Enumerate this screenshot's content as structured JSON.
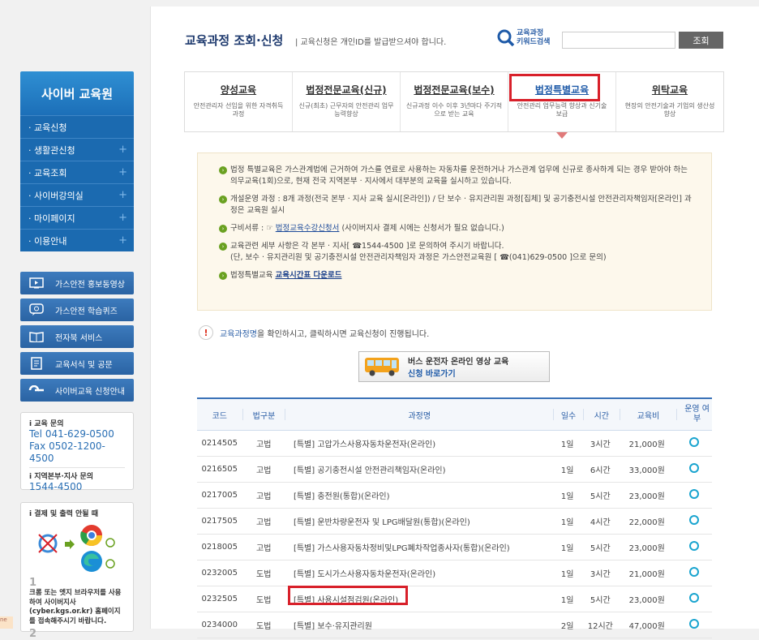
{
  "sidebar": {
    "title": "사이버 교육원",
    "menu": [
      {
        "label": "· 교육신청",
        "plus": ""
      },
      {
        "label": "· 생활관신청",
        "plus": "+"
      },
      {
        "label": "· 교육조회",
        "plus": "+"
      },
      {
        "label": "· 사이버강의실",
        "plus": "+"
      },
      {
        "label": "· 마이페이지",
        "plus": "+"
      },
      {
        "label": "· 이용안내",
        "plus": "+"
      }
    ],
    "quick": [
      {
        "label": "가스안전 홍보동영상",
        "icon": "video-icon"
      },
      {
        "label": "가스안전 학습퀴즈",
        "icon": "quiz-icon"
      },
      {
        "label": "전자북 서비스",
        "icon": "book-icon"
      },
      {
        "label": "교육서식 및 공문",
        "icon": "document-icon"
      },
      {
        "label": "사이버교육 신청안내",
        "icon": "guide-icon"
      }
    ],
    "contact": {
      "label1": "i 교육 문의",
      "tel": "Tel 041-629-0500",
      "fax": "Fax 0502-1200-4500",
      "label2": "i 지역본부·지사 문의",
      "branch_tel": "1544-4500"
    },
    "browser": {
      "label": "i 결제 및 출력 안될 때",
      "step": "1",
      "text": "크롬 또는 엣지 브라우저를 사용하여 사이버지사 (cyber.kgs.or.kr) 홈페이지를 접속해주시기 바랍니다.",
      "step2": "2"
    },
    "corner": "ne"
  },
  "header": {
    "title": "교육과정 조회·신청",
    "subtitle": "| 교육신청은 개인ID를 발급받으셔야 합니다.",
    "keyword_label_1": "교육과정",
    "keyword_label_2": "키워드검색",
    "search_button": "조회"
  },
  "tabs": [
    {
      "label": "양성교육",
      "desc": "안전관리자 선임을 위한 자격취득 과정"
    },
    {
      "label": "법정전문교육(신규)",
      "desc": "신규(최초) 근무자의 안전관리 업무능력향상"
    },
    {
      "label": "법정전문교육(보수)",
      "desc": "신규과정 이수 이후 3년마다 주기적으로 받는 교육"
    },
    {
      "label": "법정특별교육",
      "desc": "안전관리 업무능력 향상과 신기술 보급"
    },
    {
      "label": "위탁교육",
      "desc": "현장의 안전기술과 기업의 생산성 향상"
    }
  ],
  "info": {
    "p1": "법정 특별교육은 가스관계법에 근거하여 가스를 연료로 사용하는 자동차를 운전하거나 가스관계 업무에 신규로 종사하게 되는 경우 받아야 하는 의무교육(1회)으로, 현재 전국 지역본부 · 지사에서 대부분의 교육을 실시하고 있습니다.",
    "p2": "개설운영 과정 : 8개 과정(전국 본부 · 지사 교육 실시[온라인]) / 단 보수 · 유지관리원 과정[집체] 및 공기충전시설 안전관리자책임자[온라인] 과정은 교육원 실시",
    "p3_pre": "구비서류 : ☞",
    "p3_link": "법정교육수강신청서",
    "p3_post": "(사이버지사 결제 시에는 신청서가 필요 없습니다.)",
    "p4a": "교육관련 세부 사항은 각 본부 · 지사[ ☎1544-4500 ]로 문의하여 주시기 바랍니다.",
    "p4b": "(단, 보수 · 유지관리원 및 공기충전시설 안전관리자책임자 과정은 가스안전교육원 [ ☎(041)629-0500 ]으로 문의)",
    "p5_pre": "법정특별교육",
    "p5_link": "교육시간표 다운로드"
  },
  "notice": {
    "highlight": "교육과정명",
    "text": "을 확인하시고, 클릭하시면 교육신청이 진행됩니다."
  },
  "bus_banner": {
    "line1": "버스 운전자 온라인 영상 교육",
    "line2": "신청 바로가기"
  },
  "table": {
    "headers": {
      "code": "코드",
      "law": "법구분",
      "course": "과정명",
      "days": "일수",
      "hours": "시간",
      "fee": "교육비",
      "status": "운영 여부"
    },
    "rows": [
      {
        "code": "0214505",
        "law": "고법",
        "course": "[특별] 고압가스사용자동차운전자(온라인)",
        "days": "1일",
        "hours": "3시간",
        "fee": "21,000원"
      },
      {
        "code": "0216505",
        "law": "고법",
        "course": "[특별] 공기충전시설 안전관리책임자(온라인)",
        "days": "1일",
        "hours": "6시간",
        "fee": "33,000원"
      },
      {
        "code": "0217005",
        "law": "고법",
        "course": "[특별] 충전원(통합)(온라인)",
        "days": "1일",
        "hours": "5시간",
        "fee": "23,000원"
      },
      {
        "code": "0217505",
        "law": "고법",
        "course": "[특별] 운반차량운전자 및 LPG배달원(통합)(온라인)",
        "days": "1일",
        "hours": "4시간",
        "fee": "22,000원"
      },
      {
        "code": "0218005",
        "law": "고법",
        "course": "[특별] 가스사용자동차정비및LPG폐차작업종사자(통합)(온라인)",
        "days": "1일",
        "hours": "5시간",
        "fee": "23,000원"
      },
      {
        "code": "0232005",
        "law": "도법",
        "course": "[특별] 도시가스사용자동차운전자(온라인)",
        "days": "1일",
        "hours": "3시간",
        "fee": "21,000원"
      },
      {
        "code": "0232505",
        "law": "도법",
        "course": "[특별] 사용시설점검원(온라인)",
        "days": "1일",
        "hours": "5시간",
        "fee": "23,000원"
      },
      {
        "code": "0234000",
        "law": "도법",
        "course": "[특별] 보수·유지관리원",
        "days": "2일",
        "hours": "12시간",
        "fee": "47,000원"
      }
    ]
  },
  "colors": {
    "accent": "#1c6fb8",
    "highlight_red": "#d8202a",
    "status_ring": "#19a4cf"
  }
}
